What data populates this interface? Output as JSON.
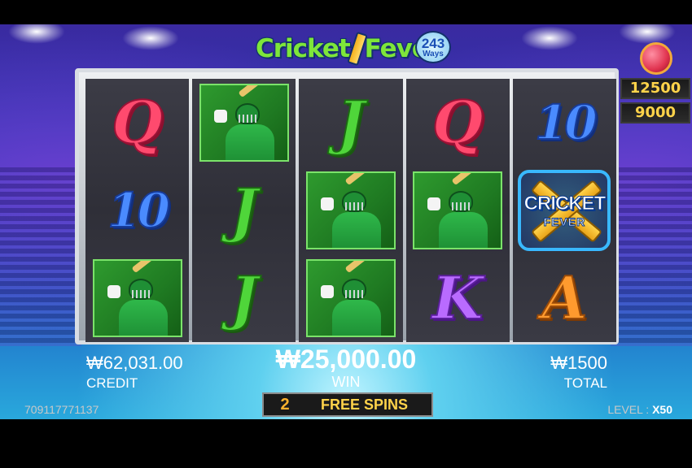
{
  "game": {
    "title_part1": "Cricket",
    "title_part2": "Fever",
    "ways_number": "243",
    "ways_label": "Ways"
  },
  "jackpots": [
    "12500",
    "9000"
  ],
  "reels": [
    [
      "Q",
      "10",
      "player"
    ],
    [
      "player",
      "J",
      "J"
    ],
    [
      "J",
      "player",
      "player"
    ],
    [
      "Q",
      "player",
      "K"
    ],
    [
      "10",
      "wild",
      "A"
    ]
  ],
  "wild_symbol": {
    "line1": "CRICKET",
    "line2": "FEVER"
  },
  "meters": {
    "credit_value": "₩62,031.00",
    "credit_label": "CREDIT",
    "win_value": "₩25,000.00",
    "win_label": "WIN",
    "total_value": "₩1500",
    "total_label": "TOTAL"
  },
  "free_spins": {
    "count": "2",
    "label": "FREE SPINS"
  },
  "footer": {
    "machine_id": "709117771137",
    "level_label": "LEVEL :",
    "level_value": "X50"
  },
  "colors": {
    "accent_gold": "#ffd34a",
    "free_spin_count": "#ffb22e",
    "stage_blue": "#2a3ab8"
  }
}
